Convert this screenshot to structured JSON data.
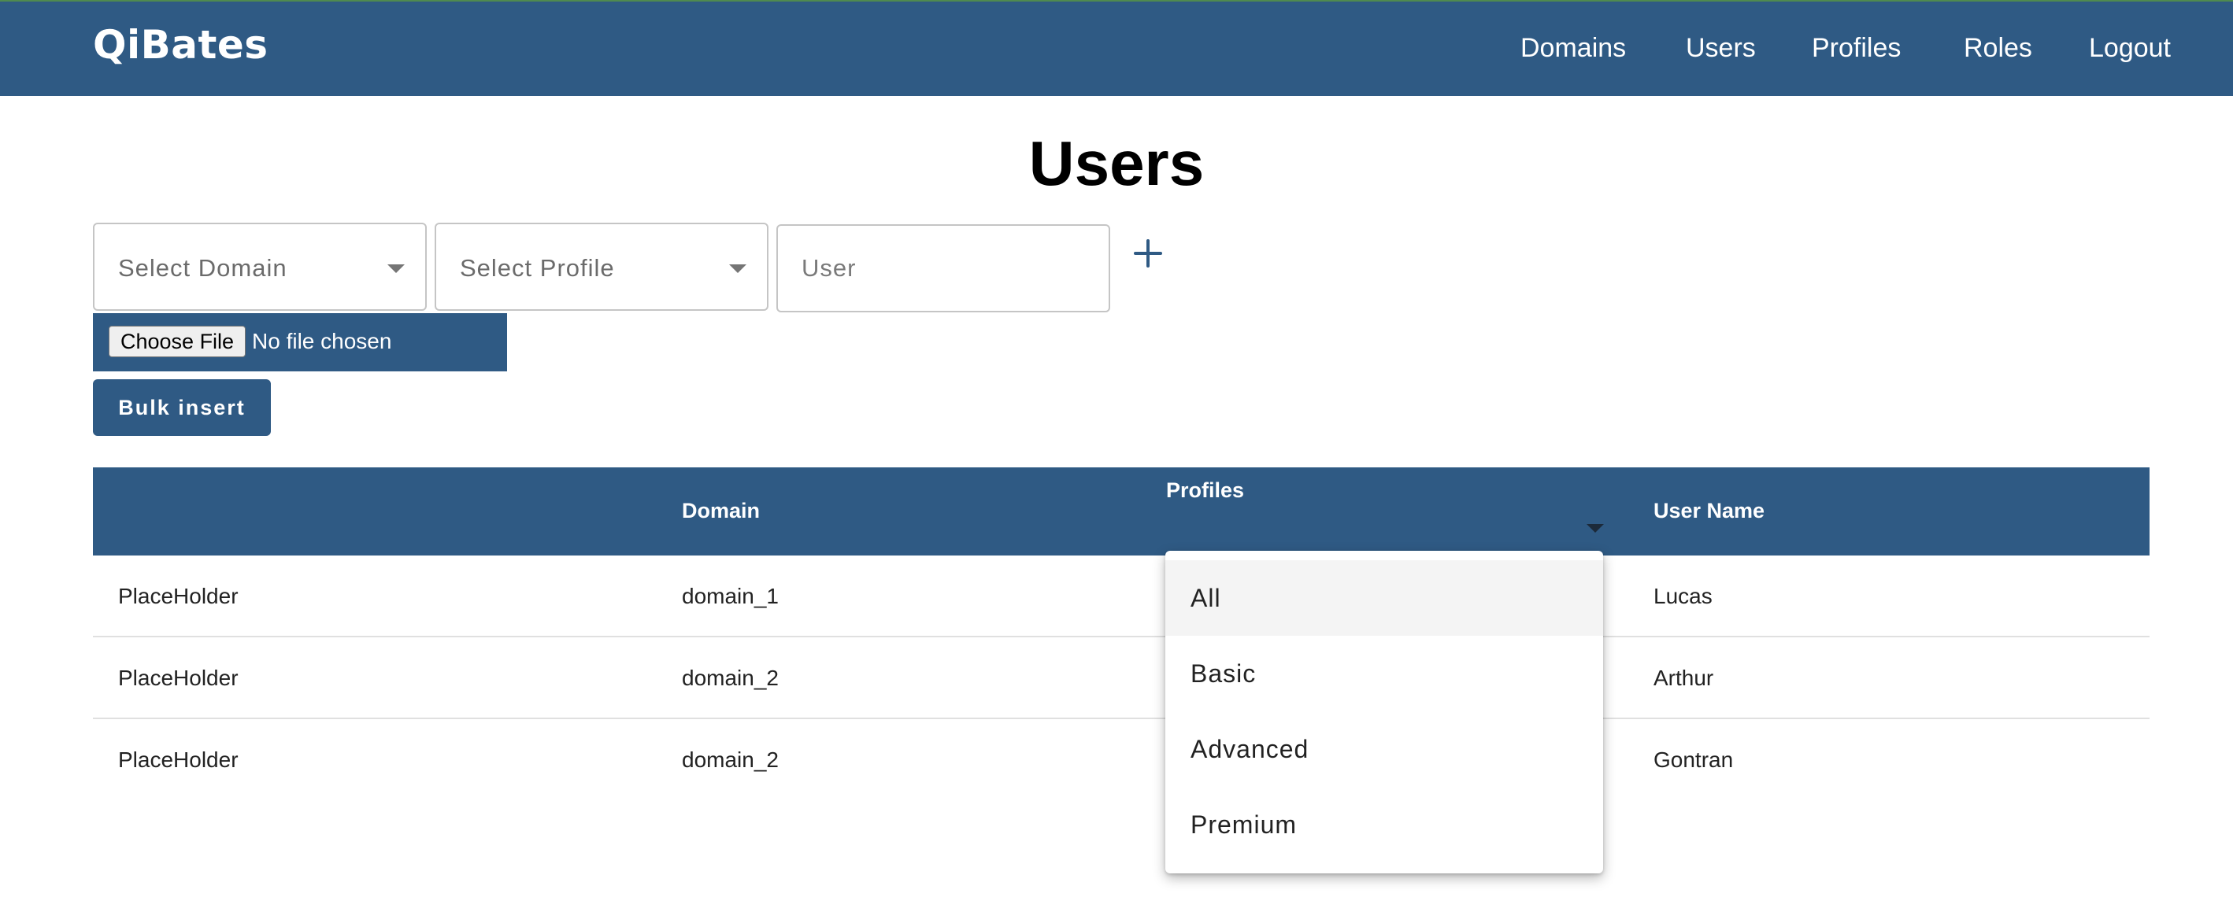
{
  "header": {
    "brand": "QiBates",
    "nav": [
      "Domains",
      "Users",
      "Profiles",
      "Roles",
      "Logout"
    ]
  },
  "page": {
    "title": "Users"
  },
  "form": {
    "domain_placeholder": "Select Domain",
    "profile_placeholder": "Select Profile",
    "user_placeholder": "User",
    "add_icon": "plus-icon",
    "choose_file_label": "Choose File",
    "file_status": "No file chosen",
    "bulk_insert_label": "Bulk insert"
  },
  "table": {
    "headers": [
      "",
      "Domain",
      "Profiles",
      "User Name"
    ],
    "rows": [
      [
        "PlaceHolder",
        "domain_1",
        "",
        "Lucas"
      ],
      [
        "PlaceHolder",
        "domain_2",
        "",
        "Arthur"
      ],
      [
        "PlaceHolder",
        "domain_2",
        "",
        "Gontran"
      ]
    ]
  },
  "profiles_filter": {
    "options": [
      "All",
      "Basic",
      "Advanced",
      "Premium"
    ],
    "highlighted": "All"
  },
  "colors": {
    "primary": "#2f5a84",
    "header_text": "#ffffff",
    "row_divider": "#e0e0e0"
  }
}
